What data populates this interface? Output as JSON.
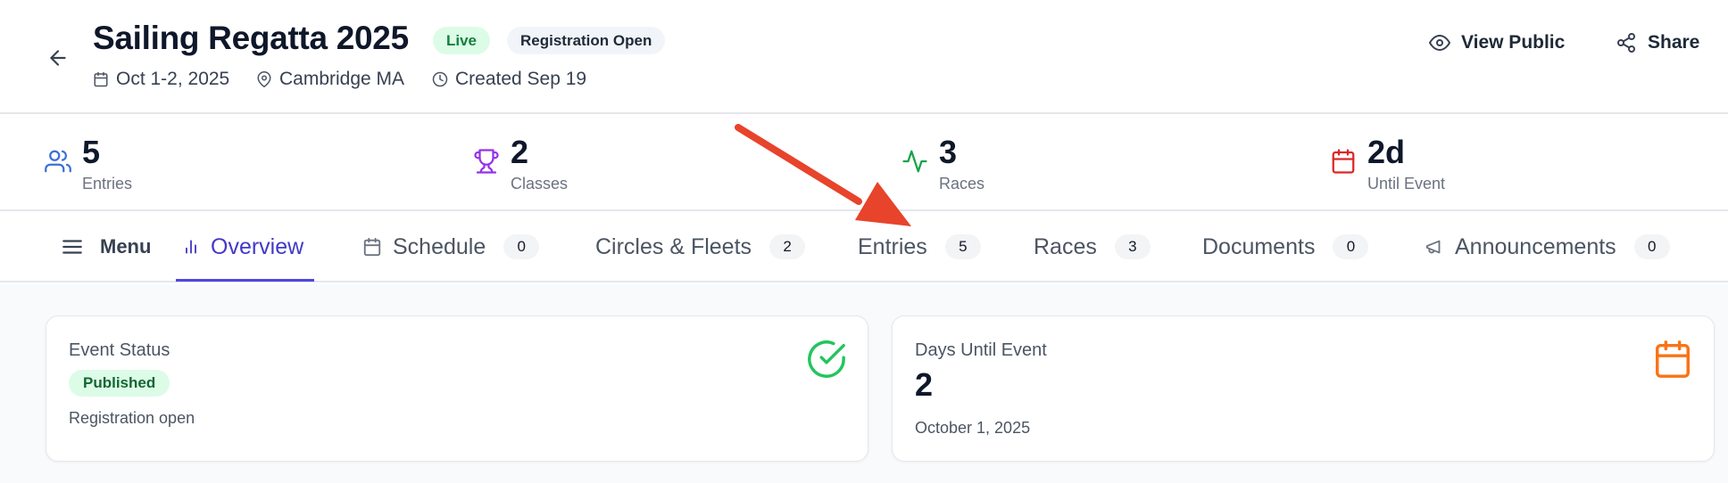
{
  "header": {
    "title": "Sailing Regatta 2025",
    "badges": [
      "Live",
      "Registration Open"
    ],
    "meta": {
      "dates": "Oct 1-2, 2025",
      "location": "Cambridge MA",
      "created": "Created Sep 19"
    },
    "actions": {
      "view_public": "View Public",
      "share": "Share"
    }
  },
  "stats": [
    {
      "value": "5",
      "label": "Entries",
      "icon": "users-icon",
      "color": "#3b6fd9"
    },
    {
      "value": "2",
      "label": "Classes",
      "icon": "trophy-icon",
      "color": "#9333ea"
    },
    {
      "value": "3",
      "label": "Races",
      "icon": "activity-icon",
      "color": "#16a34a"
    },
    {
      "value": "2d",
      "label": "Until Event",
      "icon": "calendar-icon",
      "color": "#dc2626"
    }
  ],
  "tabs": {
    "menu_label": "Menu",
    "items": [
      {
        "label": "Overview",
        "count": null,
        "active": true
      },
      {
        "label": "Schedule",
        "count": "0"
      },
      {
        "label": "Circles & Fleets",
        "count": "2"
      },
      {
        "label": "Entries",
        "count": "5"
      },
      {
        "label": "Races",
        "count": "3"
      },
      {
        "label": "Documents",
        "count": "0"
      },
      {
        "label": "Announcements",
        "count": "0"
      }
    ]
  },
  "cards": {
    "status": {
      "title": "Event Status",
      "badge": "Published",
      "subtitle": "Registration open",
      "icon": "check-circle-icon",
      "icon_color": "#22c55e"
    },
    "days": {
      "title": "Days Until Event",
      "value": "2",
      "date": "October 1, 2025",
      "icon": "calendar-icon",
      "icon_color": "#f97316"
    }
  },
  "colors": {
    "accent": "#4f46e5",
    "annotation_arrow": "#e8432b"
  }
}
